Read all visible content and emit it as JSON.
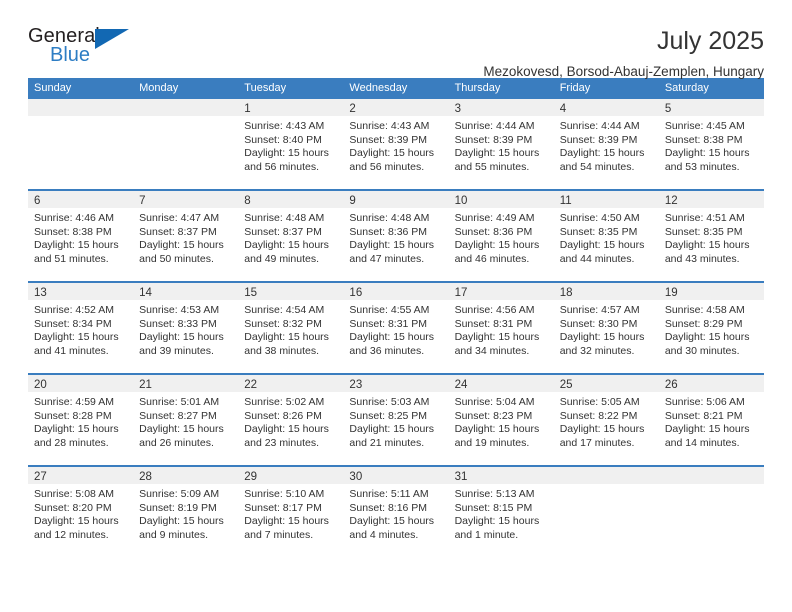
{
  "brand": {
    "name_top": "General",
    "name_bottom": "Blue",
    "triangle_color": "#1268b3",
    "blue_color": "#2d7dc4"
  },
  "header": {
    "title": "July 2025",
    "subtitle": "Mezokovesd, Borsod-Abauj-Zemplen, Hungary"
  },
  "theme": {
    "header_bar": "#3a7dbf",
    "daynum_strip": "#f0f0f0",
    "row_divider": "#3a7dbf",
    "text": "#333333"
  },
  "weekdays": [
    "Sunday",
    "Monday",
    "Tuesday",
    "Wednesday",
    "Thursday",
    "Friday",
    "Saturday"
  ],
  "weeks": [
    [
      {
        "day": "",
        "lines": []
      },
      {
        "day": "",
        "lines": []
      },
      {
        "day": "1",
        "lines": [
          "Sunrise: 4:43 AM",
          "Sunset: 8:40 PM",
          "Daylight: 15 hours",
          "and 56 minutes."
        ]
      },
      {
        "day": "2",
        "lines": [
          "Sunrise: 4:43 AM",
          "Sunset: 8:39 PM",
          "Daylight: 15 hours",
          "and 56 minutes."
        ]
      },
      {
        "day": "3",
        "lines": [
          "Sunrise: 4:44 AM",
          "Sunset: 8:39 PM",
          "Daylight: 15 hours",
          "and 55 minutes."
        ]
      },
      {
        "day": "4",
        "lines": [
          "Sunrise: 4:44 AM",
          "Sunset: 8:39 PM",
          "Daylight: 15 hours",
          "and 54 minutes."
        ]
      },
      {
        "day": "5",
        "lines": [
          "Sunrise: 4:45 AM",
          "Sunset: 8:38 PM",
          "Daylight: 15 hours",
          "and 53 minutes."
        ]
      }
    ],
    [
      {
        "day": "6",
        "lines": [
          "Sunrise: 4:46 AM",
          "Sunset: 8:38 PM",
          "Daylight: 15 hours",
          "and 51 minutes."
        ]
      },
      {
        "day": "7",
        "lines": [
          "Sunrise: 4:47 AM",
          "Sunset: 8:37 PM",
          "Daylight: 15 hours",
          "and 50 minutes."
        ]
      },
      {
        "day": "8",
        "lines": [
          "Sunrise: 4:48 AM",
          "Sunset: 8:37 PM",
          "Daylight: 15 hours",
          "and 49 minutes."
        ]
      },
      {
        "day": "9",
        "lines": [
          "Sunrise: 4:48 AM",
          "Sunset: 8:36 PM",
          "Daylight: 15 hours",
          "and 47 minutes."
        ]
      },
      {
        "day": "10",
        "lines": [
          "Sunrise: 4:49 AM",
          "Sunset: 8:36 PM",
          "Daylight: 15 hours",
          "and 46 minutes."
        ]
      },
      {
        "day": "11",
        "lines": [
          "Sunrise: 4:50 AM",
          "Sunset: 8:35 PM",
          "Daylight: 15 hours",
          "and 44 minutes."
        ]
      },
      {
        "day": "12",
        "lines": [
          "Sunrise: 4:51 AM",
          "Sunset: 8:35 PM",
          "Daylight: 15 hours",
          "and 43 minutes."
        ]
      }
    ],
    [
      {
        "day": "13",
        "lines": [
          "Sunrise: 4:52 AM",
          "Sunset: 8:34 PM",
          "Daylight: 15 hours",
          "and 41 minutes."
        ]
      },
      {
        "day": "14",
        "lines": [
          "Sunrise: 4:53 AM",
          "Sunset: 8:33 PM",
          "Daylight: 15 hours",
          "and 39 minutes."
        ]
      },
      {
        "day": "15",
        "lines": [
          "Sunrise: 4:54 AM",
          "Sunset: 8:32 PM",
          "Daylight: 15 hours",
          "and 38 minutes."
        ]
      },
      {
        "day": "16",
        "lines": [
          "Sunrise: 4:55 AM",
          "Sunset: 8:31 PM",
          "Daylight: 15 hours",
          "and 36 minutes."
        ]
      },
      {
        "day": "17",
        "lines": [
          "Sunrise: 4:56 AM",
          "Sunset: 8:31 PM",
          "Daylight: 15 hours",
          "and 34 minutes."
        ]
      },
      {
        "day": "18",
        "lines": [
          "Sunrise: 4:57 AM",
          "Sunset: 8:30 PM",
          "Daylight: 15 hours",
          "and 32 minutes."
        ]
      },
      {
        "day": "19",
        "lines": [
          "Sunrise: 4:58 AM",
          "Sunset: 8:29 PM",
          "Daylight: 15 hours",
          "and 30 minutes."
        ]
      }
    ],
    [
      {
        "day": "20",
        "lines": [
          "Sunrise: 4:59 AM",
          "Sunset: 8:28 PM",
          "Daylight: 15 hours",
          "and 28 minutes."
        ]
      },
      {
        "day": "21",
        "lines": [
          "Sunrise: 5:01 AM",
          "Sunset: 8:27 PM",
          "Daylight: 15 hours",
          "and 26 minutes."
        ]
      },
      {
        "day": "22",
        "lines": [
          "Sunrise: 5:02 AM",
          "Sunset: 8:26 PM",
          "Daylight: 15 hours",
          "and 23 minutes."
        ]
      },
      {
        "day": "23",
        "lines": [
          "Sunrise: 5:03 AM",
          "Sunset: 8:25 PM",
          "Daylight: 15 hours",
          "and 21 minutes."
        ]
      },
      {
        "day": "24",
        "lines": [
          "Sunrise: 5:04 AM",
          "Sunset: 8:23 PM",
          "Daylight: 15 hours",
          "and 19 minutes."
        ]
      },
      {
        "day": "25",
        "lines": [
          "Sunrise: 5:05 AM",
          "Sunset: 8:22 PM",
          "Daylight: 15 hours",
          "and 17 minutes."
        ]
      },
      {
        "day": "26",
        "lines": [
          "Sunrise: 5:06 AM",
          "Sunset: 8:21 PM",
          "Daylight: 15 hours",
          "and 14 minutes."
        ]
      }
    ],
    [
      {
        "day": "27",
        "lines": [
          "Sunrise: 5:08 AM",
          "Sunset: 8:20 PM",
          "Daylight: 15 hours",
          "and 12 minutes."
        ]
      },
      {
        "day": "28",
        "lines": [
          "Sunrise: 5:09 AM",
          "Sunset: 8:19 PM",
          "Daylight: 15 hours",
          "and 9 minutes."
        ]
      },
      {
        "day": "29",
        "lines": [
          "Sunrise: 5:10 AM",
          "Sunset: 8:17 PM",
          "Daylight: 15 hours",
          "and 7 minutes."
        ]
      },
      {
        "day": "30",
        "lines": [
          "Sunrise: 5:11 AM",
          "Sunset: 8:16 PM",
          "Daylight: 15 hours",
          "and 4 minutes."
        ]
      },
      {
        "day": "31",
        "lines": [
          "Sunrise: 5:13 AM",
          "Sunset: 8:15 PM",
          "Daylight: 15 hours",
          "and 1 minute."
        ]
      },
      {
        "day": "",
        "lines": []
      },
      {
        "day": "",
        "lines": []
      }
    ]
  ]
}
